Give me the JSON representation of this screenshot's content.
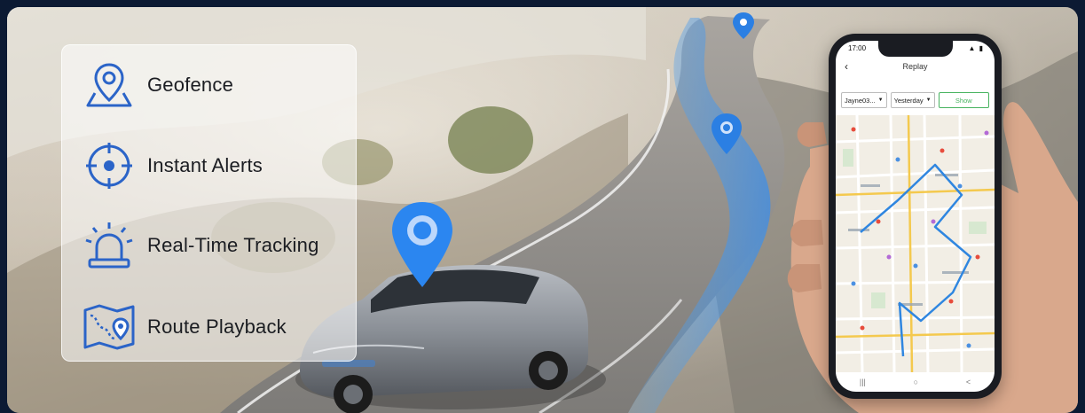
{
  "features": [
    {
      "label": "Geofence",
      "icon": "geofence-icon"
    },
    {
      "label": "Instant Alerts",
      "icon": "crosshair-icon"
    },
    {
      "label": "Real-Time Tracking",
      "icon": "siren-icon"
    },
    {
      "label": "Route Playback",
      "icon": "route-map-icon"
    }
  ],
  "phone": {
    "time": "17:00",
    "status_icons": "▲ ▮",
    "title": "Replay",
    "back_glyph": "‹",
    "device_select": "Jayne03...",
    "date_select": "Yesterday",
    "show_button": "Show",
    "nav_recents": "|||",
    "nav_home": "○",
    "nav_back": "<"
  },
  "colors": {
    "accent": "#1e6fe0",
    "icon_stroke": "#2b64c8",
    "route": "#2f86e0",
    "show_green": "#47b35f"
  }
}
